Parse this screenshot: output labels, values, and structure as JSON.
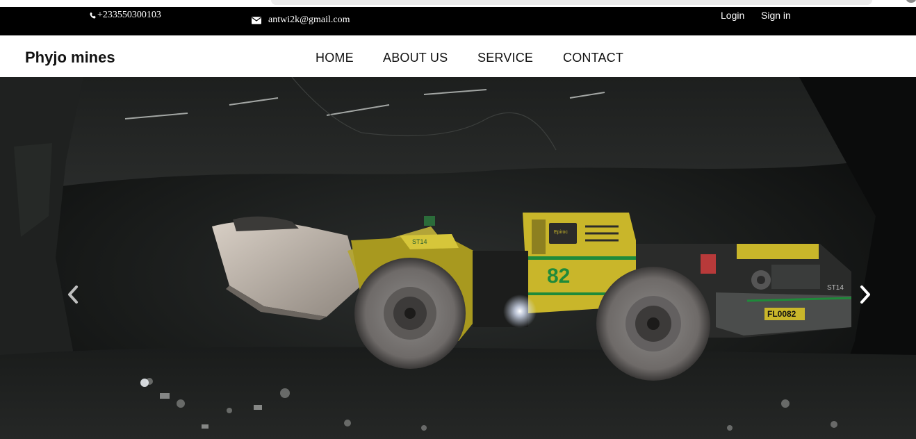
{
  "topbar": {
    "phone": "+233550300103",
    "email": "antwi2k@gmail.com",
    "login_label": "Login",
    "signin_label": "Sign in"
  },
  "navbar": {
    "brand": "Phyjo mines",
    "links": [
      "HOME",
      "ABOUT US",
      "SERVICE",
      "CONTACT"
    ]
  },
  "hero": {
    "image_subject": "underground mining loader",
    "vehicle_brand": "Epiroc",
    "vehicle_model": "ST14",
    "vehicle_number": "82",
    "plate": "FL0082",
    "prev_icon": "chevron-left-icon",
    "next_icon": "chevron-right-icon"
  },
  "colors": {
    "topbar_bg": "#000000",
    "navbar_bg": "#ffffff",
    "loader_yellow": "#c9b62a",
    "loader_green": "#1f8a3a"
  }
}
